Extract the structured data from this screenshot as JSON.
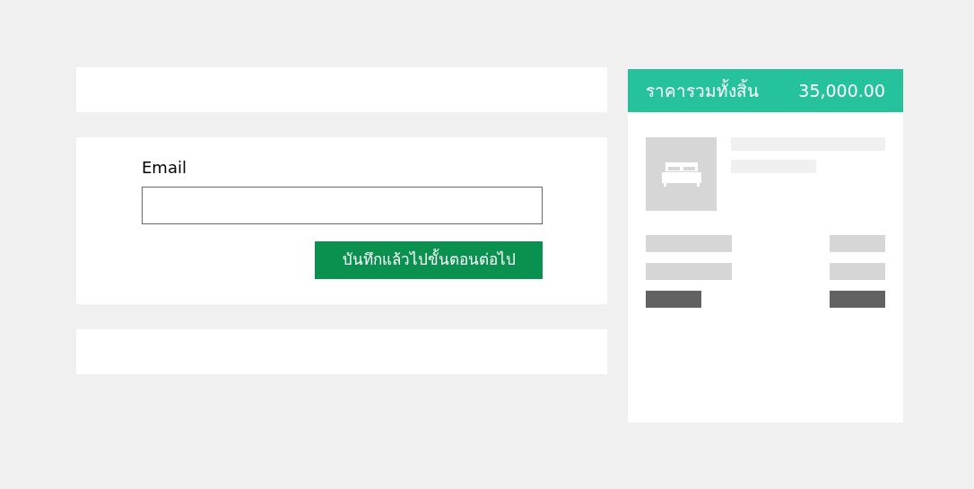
{
  "form": {
    "email_label": "Email",
    "submit_button": "บันทึกแล้วไปขั้นตอนต่อไป"
  },
  "summary": {
    "total_label": "ราคารวมทั้งสิ้น",
    "total_value": "35,000.00"
  }
}
